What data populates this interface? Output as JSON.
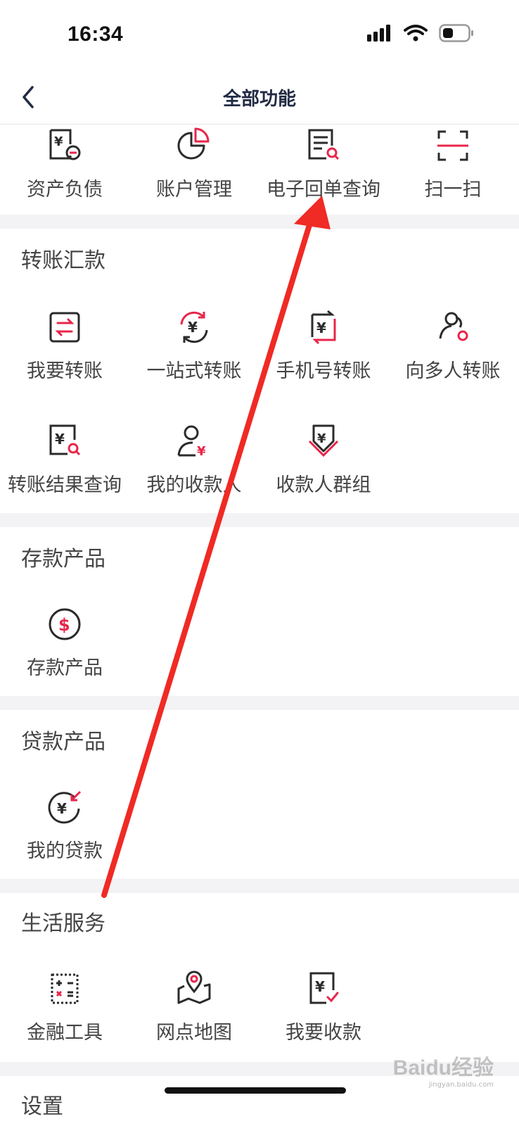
{
  "status": {
    "time": "16:34"
  },
  "nav": {
    "title": "全部功能"
  },
  "top_items": [
    {
      "label": "资产负债",
      "icon": "asset-liability-icon"
    },
    {
      "label": "账户管理",
      "icon": "account-management-icon"
    },
    {
      "label": "电子回单查询",
      "icon": "e-receipt-query-icon"
    },
    {
      "label": "扫一扫",
      "icon": "scan-icon"
    }
  ],
  "sections": [
    {
      "title": "转账汇款",
      "items": [
        {
          "label": "我要转账",
          "icon": "transfer-icon"
        },
        {
          "label": "一站式转账",
          "icon": "one-stop-transfer-icon"
        },
        {
          "label": "手机号转账",
          "icon": "phone-transfer-icon"
        },
        {
          "label": "向多人转账",
          "icon": "multi-transfer-icon"
        },
        {
          "label": "转账结果查询",
          "icon": "transfer-result-query-icon"
        },
        {
          "label": "我的收款人",
          "icon": "payee-icon"
        },
        {
          "label": "收款人群组",
          "icon": "payee-group-icon"
        }
      ]
    },
    {
      "title": "存款产品",
      "items": [
        {
          "label": "存款产品",
          "icon": "deposit-icon"
        }
      ]
    },
    {
      "title": "贷款产品",
      "items": [
        {
          "label": "我的贷款",
          "icon": "loan-icon"
        }
      ]
    },
    {
      "title": "生活服务",
      "items": [
        {
          "label": "金融工具",
          "icon": "calculator-icon"
        },
        {
          "label": "网点地图",
          "icon": "map-icon"
        },
        {
          "label": "我要收款",
          "icon": "receive-payment-icon"
        }
      ]
    },
    {
      "title": "设置",
      "items": []
    }
  ],
  "colors": {
    "accent": "#e8264a",
    "ink": "#2b2b2b",
    "title": "#222b45",
    "arrow": "#f02a24"
  },
  "watermark": {
    "brand": "Baidu经验",
    "url": "jingyan.baidu.com"
  }
}
